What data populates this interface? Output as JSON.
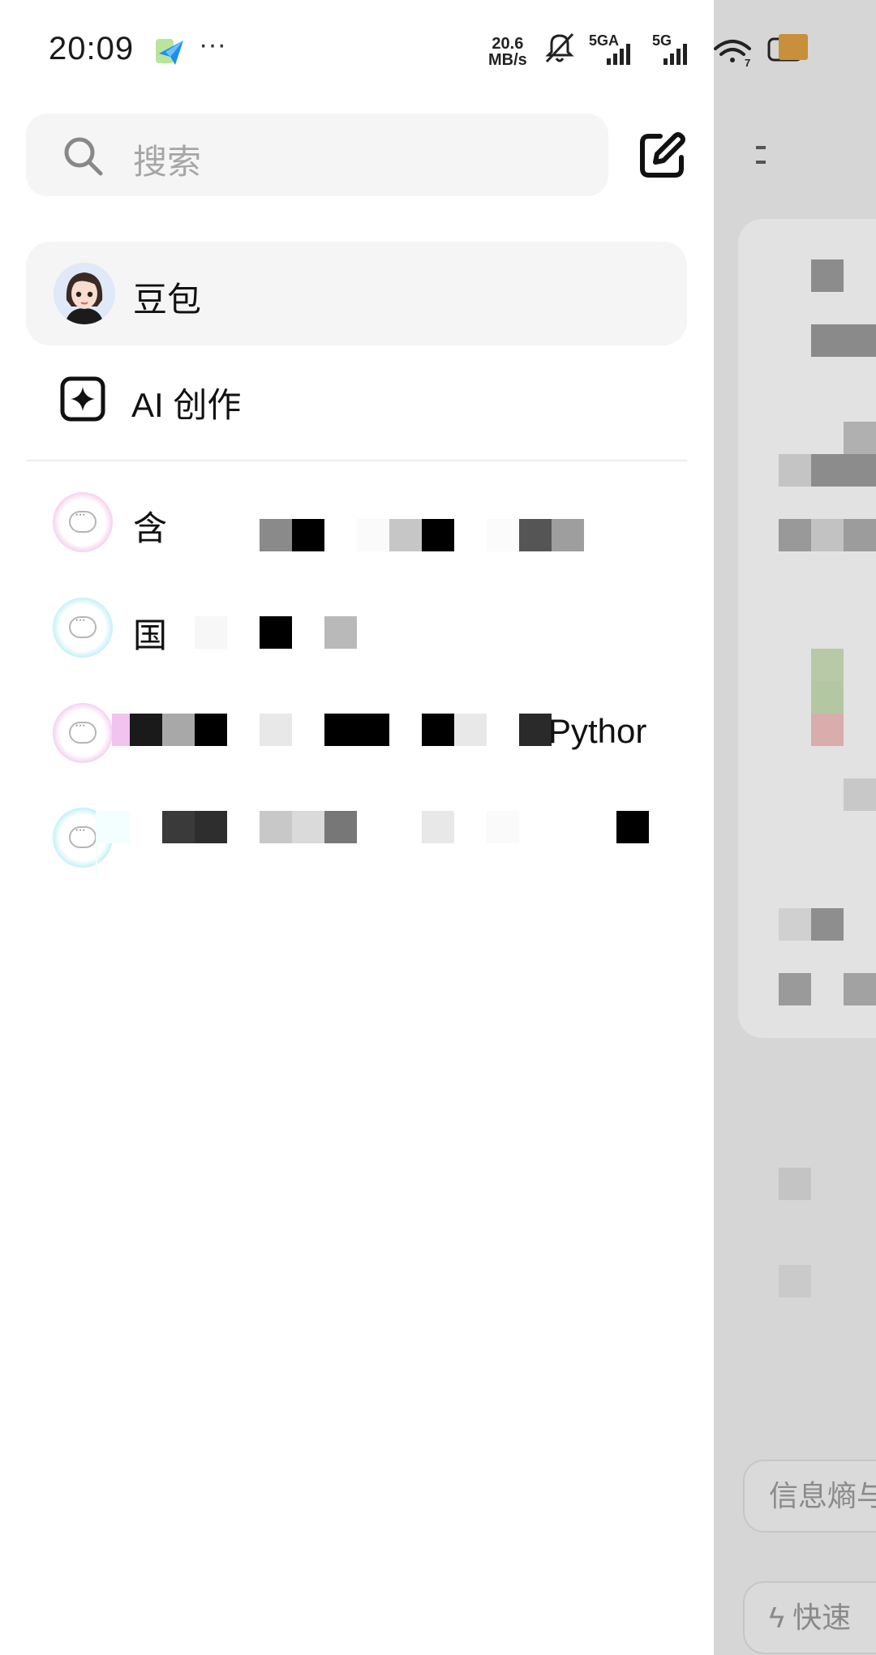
{
  "status_bar": {
    "time": "20:09",
    "more_dots": "···",
    "net_speed_value": "20.6",
    "net_speed_unit": "MB/s",
    "sim1_label": "5GA",
    "sim2_label": "5G",
    "wifi_label": "7"
  },
  "search": {
    "placeholder": "搜索",
    "icon": "search-icon"
  },
  "new_chat_icon": "edit-icon",
  "main_items": [
    {
      "label": "豆包",
      "icon": "doubao-avatar",
      "selected": true
    },
    {
      "label": "AI 创作",
      "icon": "sparkle-icon"
    }
  ],
  "chats": [
    {
      "title": "含",
      "icon": "chat-bubble-icon",
      "color": "pink"
    },
    {
      "title": "国",
      "icon": "chat-bubble-icon",
      "color": "cyan"
    },
    {
      "title": "Pythor",
      "icon": "chat-bubble-icon",
      "color": "pink"
    },
    {
      "title": "",
      "icon": "chat-bubble-icon",
      "color": "cyan"
    }
  ],
  "background_app": {
    "chip_1": "信息熵与",
    "chip_2": "快速"
  },
  "colors": {
    "drawer_bg": "#ffffff",
    "search_bg": "#f5f5f5",
    "selected_row_bg": "#f5f5f5",
    "overlay": "#d6d6d6",
    "pink_ring": "#f2c3ee",
    "cyan_ring": "#b3ecf7"
  }
}
